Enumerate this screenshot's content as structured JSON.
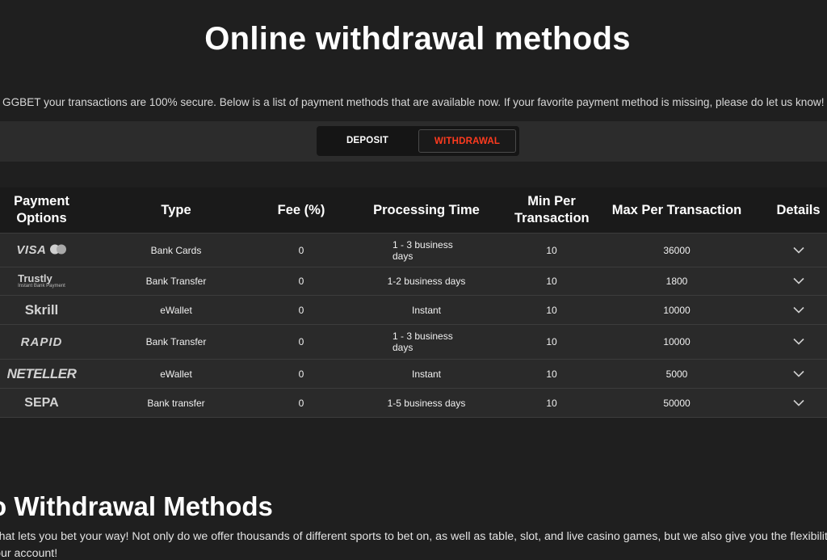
{
  "page": {
    "title": "Online withdrawal methods",
    "intro": "GGBET your transactions are 100% secure. Below is a list of payment methods that are available now. If your favorite payment method is missing, please do let us know!"
  },
  "tabs": {
    "deposit": "DEPOSIT",
    "withdrawal": "WITHDRAWAL",
    "active": "withdrawal",
    "active_color": "#ff3b1f"
  },
  "table": {
    "headers": {
      "payment_options": "Payment Options",
      "type": "Type",
      "fee": "Fee (%)",
      "processing_time": "Processing Time",
      "min": "Min Per Transaction",
      "max": "Max Per Transaction",
      "details": "Details"
    },
    "rows": [
      {
        "logo": "VISA",
        "logo_sub": "",
        "type": "Bank Cards",
        "fee": "0",
        "processing_time": "1 - 3 business days",
        "min": "10",
        "max": "36000"
      },
      {
        "logo": "Trustly",
        "logo_sub": "Instant Bank Payment",
        "type": "Bank Transfer",
        "fee": "0",
        "processing_time": "1-2 business days",
        "min": "10",
        "max": "1800"
      },
      {
        "logo": "Skrill",
        "logo_sub": "",
        "type": "eWallet",
        "fee": "0",
        "processing_time": "Instant",
        "min": "10",
        "max": "10000"
      },
      {
        "logo": "RAPID",
        "logo_sub": "",
        "type": "Bank Transfer",
        "fee": "0",
        "processing_time": "1 - 3 business days",
        "min": "10",
        "max": "10000"
      },
      {
        "logo": "NETELLER",
        "logo_sub": "",
        "type": "eWallet",
        "fee": "0",
        "processing_time": "Instant",
        "min": "10",
        "max": "5000"
      },
      {
        "logo": "SEPA",
        "logo_sub": "",
        "type": "Bank transfer",
        "fee": "0",
        "processing_time": "1-5 business days",
        "min": "10",
        "max": "50000"
      }
    ],
    "details_icon": "chevron-down-icon"
  },
  "section2": {
    "heading": "o Withdrawal Methods",
    "para_red": "r",
    "para": " that lets you bet your way! Not only do we offer thousands of different sports to bet on, as well as table, slot, and live casino games, but we also give you the flexibility to u",
    "para2": "your account!"
  },
  "colors": {
    "background": "#1f1f1f",
    "accent": "#ff3b1f",
    "row_bg": "#2a2a2a",
    "header_bg": "#1a1a1a"
  }
}
